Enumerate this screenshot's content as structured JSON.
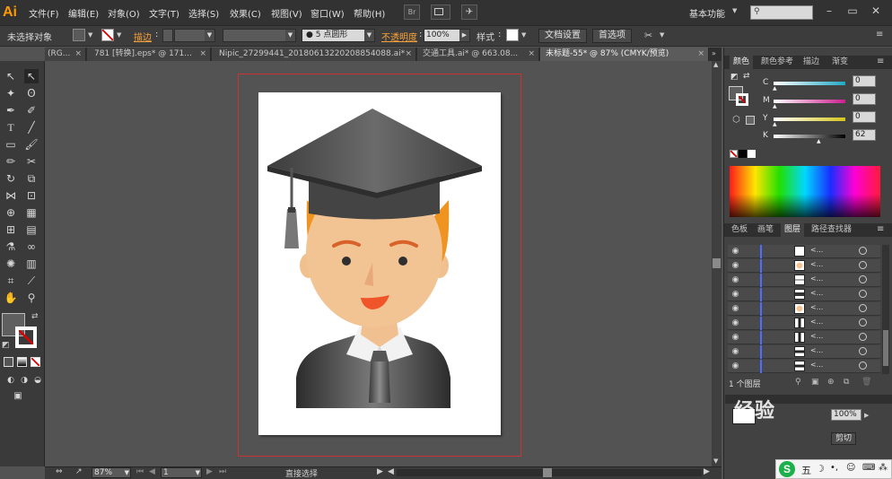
{
  "app": {
    "logo": "Ai",
    "menu": [
      "文件(F)",
      "编辑(E)",
      "对象(O)",
      "文字(T)",
      "选择(S)",
      "效果(C)",
      "视图(V)",
      "窗口(W)",
      "帮助(H)"
    ],
    "bridge_label": "Br",
    "workspace": "基本功能"
  },
  "control": {
    "selection_state": "未选择对象",
    "stroke_label": "描边",
    "brush": "5 点圆形",
    "opacity_label": "不透明度",
    "opacity_value": "100%",
    "style_label": "样式",
    "doc_setup_btn": "文档设置",
    "prefs_btn": "首选项"
  },
  "tabs": [
    {
      "label": "(RG...",
      "active": false
    },
    {
      "label": "781 [转换].eps* @ 171...",
      "active": false
    },
    {
      "label": "Nipic_27299441_20180613220208854088.ai*",
      "active": false
    },
    {
      "label": "交通工具.ai* @ 663.08...",
      "active": false
    },
    {
      "label": "未标题-55* @ 87% (CMYK/预览)",
      "active": true
    }
  ],
  "status": {
    "zoom": "87%",
    "page": "1",
    "mode": "直接选择"
  },
  "color_panel": {
    "tabs": [
      "颜色",
      "颜色参考",
      "描边",
      "渐变"
    ],
    "channels": [
      {
        "name": "C",
        "value": "0",
        "color": "#2aa7b6"
      },
      {
        "name": "M",
        "value": "0",
        "color": "#c2249a"
      },
      {
        "name": "Y",
        "value": "0",
        "color": "#c9c21a"
      },
      {
        "name": "K",
        "value": "62",
        "color": "#9c9c9c"
      }
    ]
  },
  "layers_panel": {
    "tabs": [
      "色板",
      "画笔",
      "图层",
      "路径查找器"
    ],
    "rows": [
      {
        "name": "<...",
        "thumb": "white"
      },
      {
        "name": "<...",
        "thumb": "face"
      },
      {
        "name": "<...",
        "thumb": "hair"
      },
      {
        "name": "<...",
        "thumb": "cap"
      },
      {
        "name": "<...",
        "thumb": "face"
      },
      {
        "name": "<...",
        "thumb": "tie"
      },
      {
        "name": "<...",
        "thumb": "tie"
      },
      {
        "name": "<...",
        "thumb": "suit"
      },
      {
        "name": "<...",
        "thumb": "suit"
      }
    ],
    "count_label": "1 个图层"
  },
  "transparency": {
    "opacity_value": "100%",
    "clip_btn": "剪切"
  },
  "watermark": "经验"
}
